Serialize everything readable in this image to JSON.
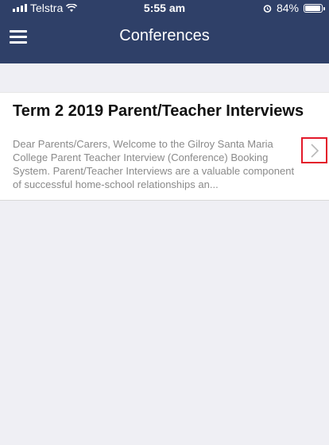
{
  "status_bar": {
    "carrier": "Telstra",
    "time": "5:55 am",
    "battery_percent": "84%"
  },
  "nav": {
    "title": "Conferences",
    "menu_icon": "hamburger-menu-icon"
  },
  "conference_item": {
    "title": "Term 2 2019 Parent/Teacher Interviews",
    "description": "Dear Parents/Carers, Welcome to the Gilroy Santa Maria College Parent Teacher Interview (Conference) Booking System. Parent/Teacher Interviews are a valuable component of successful home-school relationships an..."
  },
  "colors": {
    "nav_bg": "#2f4068",
    "highlight": "#e3192a"
  }
}
